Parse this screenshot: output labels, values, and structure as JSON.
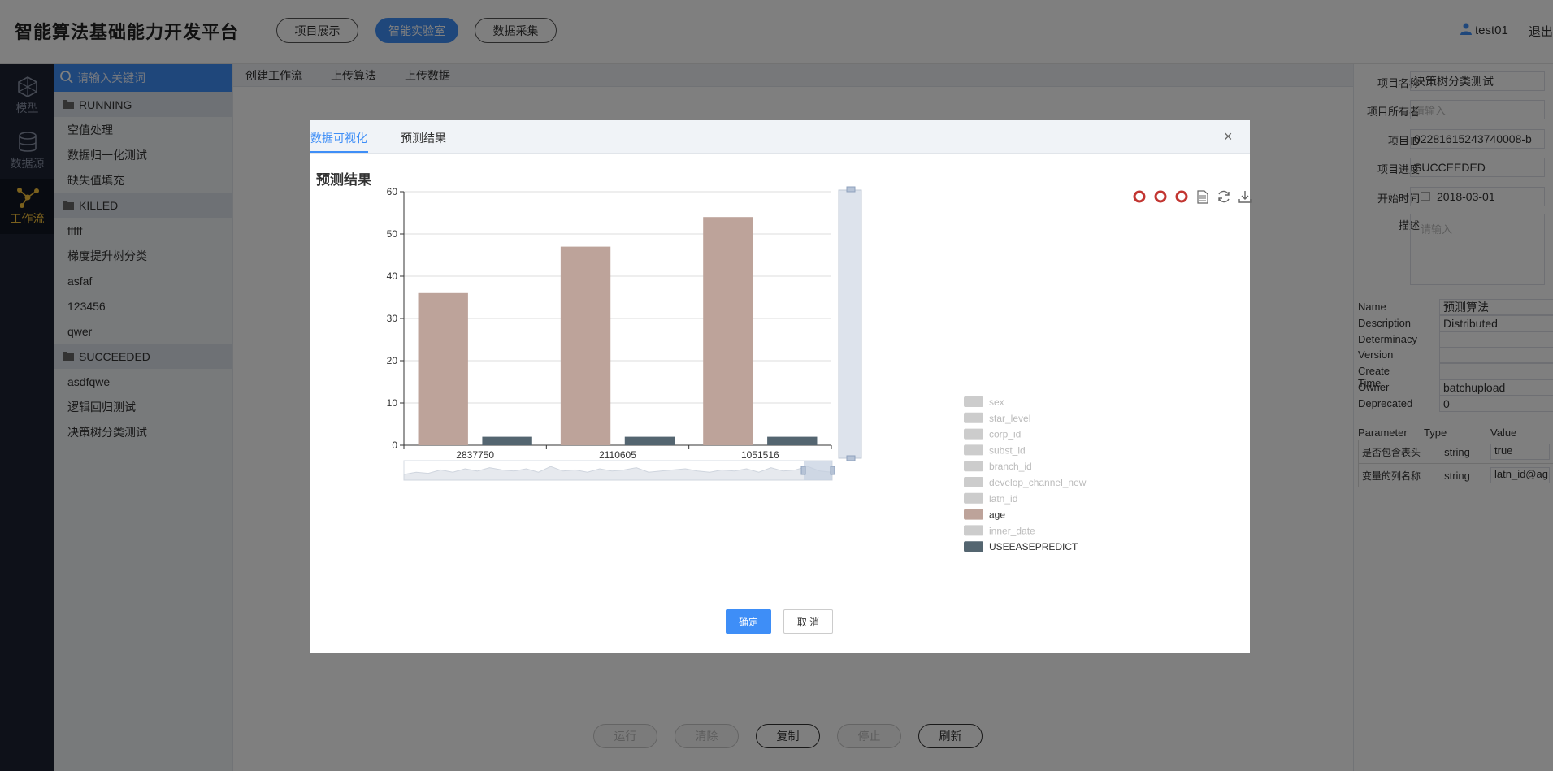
{
  "app": {
    "title": "智能算法基础能力开发平台",
    "nav": [
      "项目展示",
      "智能实验室",
      "数据采集"
    ],
    "nav_active": 1,
    "user": "test01",
    "logout": "退出"
  },
  "rail": [
    {
      "label": "模型",
      "icon": "model-icon"
    },
    {
      "label": "数据源",
      "icon": "database-icon"
    },
    {
      "label": "工作流",
      "icon": "workflow-icon",
      "active": true
    }
  ],
  "tree": {
    "search_placeholder": "请输入关键词",
    "groups": [
      {
        "name": "RUNNING",
        "items": [
          "空值处理",
          "数据归一化测试",
          "缺失值填充"
        ]
      },
      {
        "name": "KILLED",
        "items": [
          "fffff",
          "梯度提升树分类",
          "asfaf",
          "123456",
          "qwer"
        ]
      },
      {
        "name": "SUCCEEDED",
        "items": [
          "asdfqwe",
          "逻辑回归测试",
          "决策树分类测试"
        ]
      }
    ]
  },
  "toolbar": [
    "创建工作流",
    "上传算法",
    "上传数据"
  ],
  "bottom_buttons": [
    {
      "label": "运行",
      "disabled": true
    },
    {
      "label": "清除",
      "disabled": true
    },
    {
      "label": "复制",
      "disabled": false
    },
    {
      "label": "停止",
      "disabled": true
    },
    {
      "label": "刷新",
      "disabled": false
    }
  ],
  "props": {
    "fields": [
      {
        "label": "项目名称",
        "value": "决策树分类测试"
      },
      {
        "label": "项目所有者",
        "value": "",
        "placeholder": "请输入"
      },
      {
        "label": "项目ID",
        "value": "02281615243740008-b"
      },
      {
        "label": "项目进度",
        "value": "SUCCEEDED"
      },
      {
        "label": "开始时间",
        "value": "2018-03-01"
      }
    ],
    "desc_label": "描述",
    "desc_placeholder": "请输入",
    "kv": [
      {
        "k": "Name",
        "v": "预测算法"
      },
      {
        "k": "Description",
        "v": "Distributed"
      },
      {
        "k": "Determinacy",
        "v": ""
      },
      {
        "k": "Version",
        "v": ""
      },
      {
        "k": "Create Time",
        "v": ""
      },
      {
        "k": "Owner",
        "v": "batchupload"
      },
      {
        "k": "Deprecated",
        "v": "0"
      }
    ],
    "param_headers": [
      "Parameter",
      "Type",
      "Value"
    ],
    "params": [
      {
        "p": "是否包含表头",
        "t": "string",
        "v": "true"
      },
      {
        "p": "变量的列名称",
        "t": "string",
        "v": "latn_id@ag"
      }
    ]
  },
  "modal": {
    "tabs": [
      "数据可视化",
      "预测结果"
    ],
    "active_tab": 0,
    "close": "×",
    "title": "预测结果",
    "tool_icons": [
      "restore-icon",
      "restore-icon",
      "restore-icon",
      "data-view-icon",
      "refresh-icon",
      "download-icon"
    ],
    "ok": "确定",
    "cancel": "取 消"
  },
  "chart_data": {
    "type": "bar",
    "categories": [
      "2837750",
      "2110605",
      "1051516"
    ],
    "series": [
      {
        "name": "age",
        "values": [
          36,
          47,
          54
        ],
        "color": "#bda39a"
      },
      {
        "name": "USEEASEPREDICT",
        "values": [
          2,
          2,
          2
        ],
        "color": "#546570"
      }
    ],
    "ylim": [
      0,
      60
    ],
    "yticks": [
      0,
      10,
      20,
      30,
      40,
      50,
      60
    ],
    "grid": true,
    "legend_position": "right",
    "legend": [
      {
        "name": "sex",
        "active": false
      },
      {
        "name": "star_level",
        "active": false
      },
      {
        "name": "corp_id",
        "active": false
      },
      {
        "name": "subst_id",
        "active": false
      },
      {
        "name": "branch_id",
        "active": false
      },
      {
        "name": "develop_channel_new",
        "active": false
      },
      {
        "name": "latn_id",
        "active": false
      },
      {
        "name": "age",
        "active": true,
        "color": "#bda39a"
      },
      {
        "name": "inner_date",
        "active": false
      },
      {
        "name": "USEEASEPREDICT",
        "active": true,
        "color": "#546570"
      }
    ],
    "inactive_color": "#cccccc"
  }
}
